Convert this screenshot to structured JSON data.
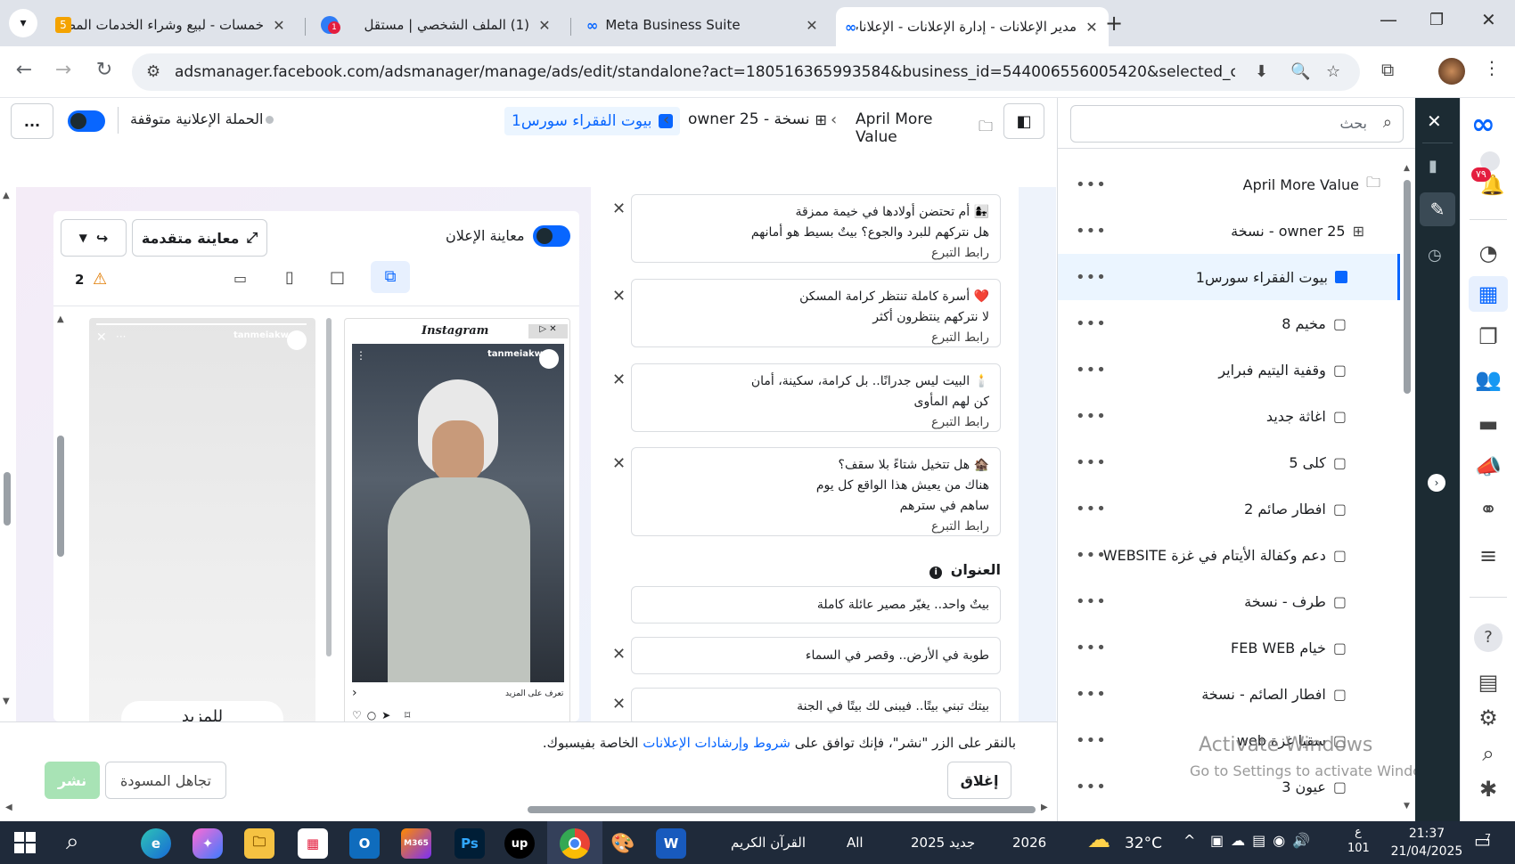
{
  "browser": {
    "tabs": [
      {
        "title": "خمسات - لبيع وشراء الخدمات المصغرة",
        "favicon": "5"
      },
      {
        "title": "(1) الملف الشخصي | مستقل",
        "favicon": "1"
      },
      {
        "title": "Meta Business Suite",
        "favicon": "meta"
      },
      {
        "title": "مدير الإعلانات - إدارة الإعلانات - الإعلانات",
        "favicon": "meta"
      }
    ],
    "url": "adsmanager.facebook.com/adsmanager/manage/ads/edit/standalone?act=180516365993584&business_id=544006556005420&selected_campaign_ids=..."
  },
  "header": {
    "campaign_status": "الحملة الإعلانية متوقفة",
    "more": "...",
    "breadcrumb": [
      "April More Value",
      "owner 25 - نسخة",
      "بيوت الفقراء سورس1"
    ]
  },
  "preview": {
    "toggle_label": "معاينة الإعلان",
    "advanced_button": "معاينة متقدمة",
    "warning_count": "2",
    "instagram_label": "Instagram",
    "account_name": "tanmeiakw",
    "story_cta": "للمزيد",
    "feed_caption": "تعرف على المزيد"
  },
  "editor": {
    "texts": [
      {
        "lines": [
          "👩‍👧 أم تحتضن أولادها في خيمة ممزقة",
          "هل نتركهم للبرد والجوع؟ بيتٌ بسيط هو أمانهم",
          "رابط التبرع"
        ]
      },
      {
        "lines": [
          "❤️ أسرة كاملة تنتظر كرامة المسكن",
          "لا نتركهم ينتظرون أكثر",
          "رابط التبرع"
        ]
      },
      {
        "lines": [
          "🕯️ البيت ليس جدرانًا.. بل كرامة، سكينة، أمان",
          "كن لهم المأوى",
          "رابط التبرع"
        ]
      },
      {
        "lines": [
          "🏚️ هل تتخيل شتاءً بلا سقف؟",
          "هناك من يعيش هذا الواقع كل يوم",
          "ساهم في سترهم",
          "رابط التبرع"
        ]
      }
    ],
    "headline_label": "العنوان",
    "headlines": [
      "بيتٌ واحد.. يغيّر مصير عائلة كاملة",
      "طوبة في الأرض.. وقصر في السماء",
      "بيتك تبني بيتًا.. فيبنى لك بيتًا في الجنة"
    ]
  },
  "footer": {
    "terms_prefix": "بالنقر على الزر \"نشر\"، فإنك توافق على",
    "terms_link": "شروط وإرشادات الإعلانات",
    "terms_suffix": "الخاصة بفيسبوك.",
    "close_button": "إغلاق",
    "discard_button": "تجاهل المسودة",
    "publish_button": "نشر"
  },
  "right_panel": {
    "search_placeholder": "بحث",
    "items": [
      {
        "label": "April More Value",
        "icon": "folder-icon",
        "level": 0
      },
      {
        "label": "owner 25 - نسخة",
        "icon": "grid-icon",
        "level": 1
      },
      {
        "label": "بيوت الفقراء سورس1",
        "icon": "ad-icon",
        "level": 2,
        "selected": true
      },
      {
        "label": "مخيم 8",
        "icon": "ad-icon",
        "level": 2
      },
      {
        "label": "وقفية اليتيم فبراير",
        "icon": "ad-icon",
        "level": 2
      },
      {
        "label": "اغاثة جديد",
        "icon": "ad-icon",
        "level": 2
      },
      {
        "label": "كلى 5",
        "icon": "ad-icon",
        "level": 2
      },
      {
        "label": "افطار صائم 2",
        "icon": "ad-icon",
        "level": 2
      },
      {
        "label": "دعم وكفالة الأيتام في غزة WEBSITE",
        "icon": "ad-icon",
        "level": 2
      },
      {
        "label": "طرف - نسخة",
        "icon": "ad-icon",
        "level": 2
      },
      {
        "label": "خيام FEB WEB",
        "icon": "ad-icon",
        "level": 2
      },
      {
        "label": "افطار الصائم - نسخة",
        "icon": "ad-icon",
        "level": 2
      },
      {
        "label": "سقيا غزة web",
        "icon": "ad-icon",
        "level": 2
      },
      {
        "label": "عيون 3",
        "icon": "ad-icon",
        "level": 2
      }
    ],
    "watermark_line1": "Activate Windows",
    "watermark_line2": "Go to Settings to activate Windows."
  },
  "sidebar": {
    "notification_badge": "٧٩"
  },
  "taskbar": {
    "items": [
      "القرآن الكريم",
      "All",
      "جديد 2025",
      "2026"
    ],
    "temperature": "32°C",
    "time": "21:37",
    "date": "21/04/2025",
    "lang": "ع",
    "lang_sub": "101",
    "notif_count": "7"
  },
  "colors": {
    "accent": "#0866ff",
    "selected_bg": "#ebf5ff",
    "publish_disabled": "#a8e3b5",
    "sidebar_dark": "#1c2b33"
  }
}
